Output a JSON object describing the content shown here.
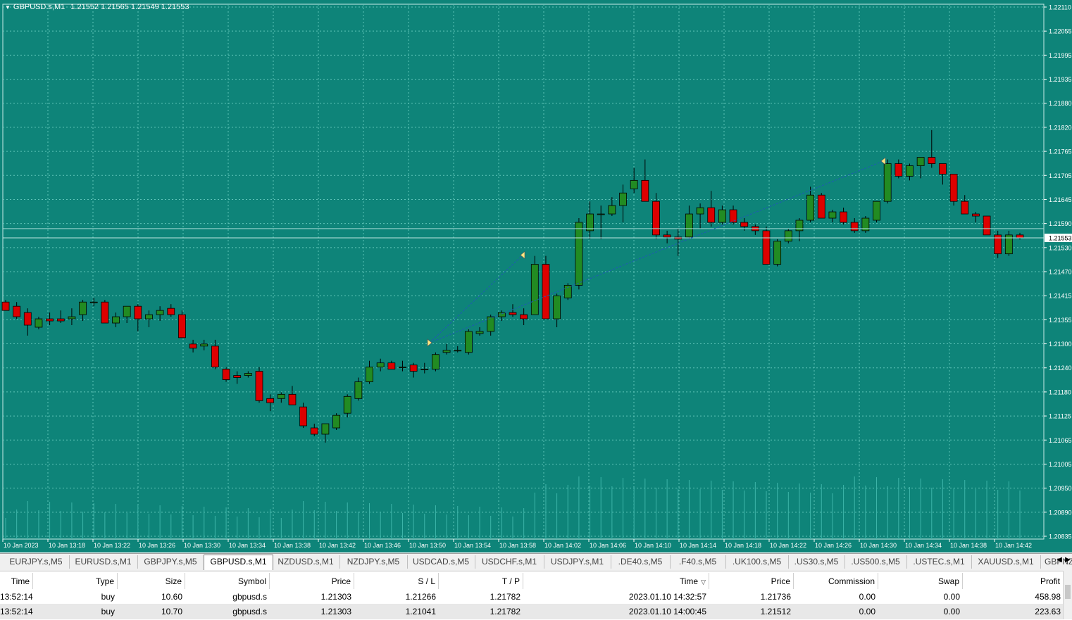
{
  "chart": {
    "symbol": "GBPUSD.s,M1",
    "header_prices": "1.21552 1.21565 1.21549 1.21553",
    "colors": {
      "background": "#0e8479",
      "bull": "#228B22",
      "bear": "#DD0000",
      "grid": "#5ec3b8",
      "trade_line": "#1e5ab4"
    },
    "price_axis_labels": [
      "1.22110",
      "1.22055",
      "1.21995",
      "1.21935",
      "1.21880",
      "1.21820",
      "1.21765",
      "1.21705",
      "1.21645",
      "1.21590",
      "1.21530",
      "1.21470",
      "1.21415",
      "1.21355",
      "1.21300",
      "1.21240",
      "1.21180",
      "1.21125",
      "1.21065",
      "1.21005",
      "1.20950",
      "1.20890",
      "1.20835"
    ],
    "current_price_label": "1.21553",
    "time_axis_labels": [
      "10 Jan 2023",
      "10 Jan 13:18",
      "10 Jan 13:22",
      "10 Jan 13:26",
      "10 Jan 13:30",
      "10 Jan 13:34",
      "10 Jan 13:38",
      "10 Jan 13:42",
      "10 Jan 13:46",
      "10 Jan 13:50",
      "10 Jan 13:54",
      "10 Jan 13:58",
      "10 Jan 14:02",
      "10 Jan 14:06",
      "10 Jan 14:10",
      "10 Jan 14:14",
      "10 Jan 14:18",
      "10 Jan 14:22",
      "10 Jan 14:26",
      "10 Jan 14:30",
      "10 Jan 14:34",
      "10 Jan 14:38",
      "10 Jan 14:42"
    ]
  },
  "chart_data": {
    "type": "candlestick",
    "symbol": "GBPUSD.s",
    "timeframe": "M1",
    "ylim": [
      1.20835,
      1.2211
    ],
    "ohlc": [
      [
        1.214,
        1.21405,
        1.2138,
        1.2138
      ],
      [
        1.2139,
        1.214,
        1.2136,
        1.21365
      ],
      [
        1.21375,
        1.21385,
        1.2132,
        1.21345
      ],
      [
        1.2134,
        1.21365,
        1.21335,
        1.2136
      ],
      [
        1.2136,
        1.21375,
        1.21345,
        1.21355
      ],
      [
        1.2136,
        1.2138,
        1.2135,
        1.21355
      ],
      [
        1.2136,
        1.21385,
        1.21345,
        1.21365
      ],
      [
        1.2137,
        1.21405,
        1.21355,
        1.214
      ],
      [
        1.214,
        1.2141,
        1.2139,
        1.214
      ],
      [
        1.214,
        1.21405,
        1.2135,
        1.2135
      ],
      [
        1.2135,
        1.21375,
        1.2134,
        1.21365
      ],
      [
        1.21365,
        1.2139,
        1.2135,
        1.2139
      ],
      [
        1.2139,
        1.21395,
        1.2133,
        1.2136
      ],
      [
        1.2136,
        1.2138,
        1.2134,
        1.2137
      ],
      [
        1.2137,
        1.2139,
        1.21355,
        1.2138
      ],
      [
        1.21385,
        1.21395,
        1.21365,
        1.2137
      ],
      [
        1.2137,
        1.2138,
        1.21315,
        1.21315
      ],
      [
        1.213,
        1.2131,
        1.2128,
        1.2129
      ],
      [
        1.21295,
        1.2131,
        1.21285,
        1.213
      ],
      [
        1.21295,
        1.2131,
        1.2124,
        1.21245
      ],
      [
        1.2124,
        1.21245,
        1.2121,
        1.21215
      ],
      [
        1.21225,
        1.21235,
        1.21205,
        1.2122
      ],
      [
        1.21225,
        1.21235,
        1.2122,
        1.2123
      ],
      [
        1.21235,
        1.21245,
        1.2116,
        1.21165
      ],
      [
        1.2117,
        1.2118,
        1.2114,
        1.2116
      ],
      [
        1.2117,
        1.21185,
        1.2116,
        1.2118
      ],
      [
        1.2118,
        1.212,
        1.2116,
        1.21155
      ],
      [
        1.2115,
        1.2116,
        1.211,
        1.21105
      ],
      [
        1.211,
        1.2111,
        1.2108,
        1.21085
      ],
      [
        1.21085,
        1.2111,
        1.21065,
        1.2111
      ],
      [
        1.211,
        1.21135,
        1.21095,
        1.2113
      ],
      [
        1.21135,
        1.2118,
        1.21125,
        1.21175
      ],
      [
        1.2117,
        1.2122,
        1.21165,
        1.2121
      ],
      [
        1.2121,
        1.2126,
        1.21205,
        1.21245
      ],
      [
        1.21245,
        1.21265,
        1.21235,
        1.21255
      ],
      [
        1.21255,
        1.2126,
        1.2124,
        1.2124
      ],
      [
        1.21245,
        1.2126,
        1.21235,
        1.21245
      ],
      [
        1.2125,
        1.21255,
        1.2122,
        1.21235
      ],
      [
        1.2124,
        1.21255,
        1.2123,
        1.2124
      ],
      [
        1.2124,
        1.2128,
        1.21235,
        1.21275
      ],
      [
        1.2128,
        1.213,
        1.21275,
        1.21285
      ],
      [
        1.21285,
        1.21295,
        1.2128,
        1.21285
      ],
      [
        1.2128,
        1.21335,
        1.21275,
        1.2133
      ],
      [
        1.21325,
        1.2134,
        1.2132,
        1.2133
      ],
      [
        1.2133,
        1.2137,
        1.2132,
        1.21365
      ],
      [
        1.21365,
        1.2138,
        1.21355,
        1.21375
      ],
      [
        1.21375,
        1.21395,
        1.21365,
        1.2137
      ],
      [
        1.2137,
        1.21385,
        1.21345,
        1.2136
      ],
      [
        1.2137,
        1.2151,
        1.2137,
        1.2149
      ],
      [
        1.2149,
        1.2151,
        1.2136,
        1.2136
      ],
      [
        1.2136,
        1.2142,
        1.2134,
        1.21415
      ],
      [
        1.2141,
        1.21445,
        1.21405,
        1.2144
      ],
      [
        1.2144,
        1.216,
        1.2143,
        1.2159
      ],
      [
        1.2157,
        1.2164,
        1.2155,
        1.2161
      ],
      [
        1.2161,
        1.2163,
        1.2155,
        1.2161
      ],
      [
        1.2161,
        1.2165,
        1.21605,
        1.2163
      ],
      [
        1.2163,
        1.2168,
        1.2159,
        1.2166
      ],
      [
        1.2167,
        1.2172,
        1.2166,
        1.2169
      ],
      [
        1.2169,
        1.2174,
        1.2164,
        1.2164
      ],
      [
        1.2164,
        1.2166,
        1.2155,
        1.2156
      ],
      [
        1.2156,
        1.2157,
        1.2154,
        1.21555
      ],
      [
        1.21555,
        1.21575,
        1.2151,
        1.2155
      ],
      [
        1.21555,
        1.2163,
        1.2155,
        1.2161
      ],
      [
        1.2161,
        1.21635,
        1.21575,
        1.21625
      ],
      [
        1.21625,
        1.21665,
        1.2158,
        1.2159
      ],
      [
        1.2159,
        1.2163,
        1.21585,
        1.2162
      ],
      [
        1.2162,
        1.2163,
        1.21585,
        1.2159
      ],
      [
        1.2159,
        1.216,
        1.2157,
        1.2158
      ],
      [
        1.2158,
        1.21585,
        1.2156,
        1.2157
      ],
      [
        1.2157,
        1.2158,
        1.2149,
        1.2149
      ],
      [
        1.2149,
        1.2155,
        1.21485,
        1.21545
      ],
      [
        1.21545,
        1.21575,
        1.2154,
        1.2157
      ],
      [
        1.2157,
        1.216,
        1.21545,
        1.21595
      ],
      [
        1.21595,
        1.21675,
        1.2159,
        1.21655
      ],
      [
        1.21655,
        1.2166,
        1.216,
        1.216
      ],
      [
        1.216,
        1.2162,
        1.2159,
        1.21615
      ],
      [
        1.21615,
        1.21625,
        1.21585,
        1.2159
      ],
      [
        1.2159,
        1.216,
        1.21565,
        1.2157
      ],
      [
        1.2157,
        1.21605,
        1.21565,
        1.216
      ],
      [
        1.21595,
        1.2164,
        1.2159,
        1.2164
      ],
      [
        1.2164,
        1.2174,
        1.21635,
        1.2173
      ],
      [
        1.2173,
        1.2174,
        1.21695,
        1.217
      ],
      [
        1.217,
        1.2173,
        1.2169,
        1.21725
      ],
      [
        1.21725,
        1.21745,
        1.21695,
        1.21745
      ],
      [
        1.21745,
        1.2181,
        1.2172,
        1.2173
      ],
      [
        1.2173,
        1.2173,
        1.2168,
        1.21705
      ],
      [
        1.21705,
        1.21705,
        1.2163,
        1.2164
      ],
      [
        1.2164,
        1.21655,
        1.2161,
        1.2161
      ],
      [
        1.2161,
        1.21615,
        1.2159,
        1.21605
      ],
      [
        1.21605,
        1.21605,
        1.2156,
        1.2156
      ],
      [
        1.2156,
        1.2157,
        1.21505,
        1.21515
      ],
      [
        1.21515,
        1.2157,
        1.2151,
        1.2156
      ],
      [
        1.2156,
        1.21565,
        1.21549,
        1.21553
      ]
    ],
    "volume_note": "tick volume histogram",
    "trades": [
      {
        "entry_time": "13:52:14",
        "entry_price": 1.21303,
        "exit_time": "14:32:57",
        "exit_price": 1.21736,
        "type": "buy"
      },
      {
        "entry_time": "13:52:14",
        "entry_price": 1.21303,
        "exit_time": "14:00:45",
        "exit_price": 1.21512,
        "type": "buy"
      }
    ]
  },
  "tabs": {
    "items": [
      "EURJPY.s,M5",
      "EURUSD.s,M1",
      "GBPJPY.s,M5",
      "GBPUSD.s,M1",
      "NZDUSD.s,M1",
      "NZDJPY.s,M5",
      "USDCAD.s,M5",
      "USDCHF.s,M1",
      "USDJPY.s,M1",
      ".DE40.s,M5",
      ".F40.s,M5",
      ".UK100.s,M5",
      ".US30.s,M5",
      ".US500.s,M5",
      ".USTEC.s,M1",
      "XAUUSD.s,M1",
      "GBPNZD"
    ],
    "active": "GBPUSD.s,M1"
  },
  "table": {
    "headers": [
      "Time",
      "Type",
      "Size",
      "Symbol",
      "Price",
      "S / L",
      "T / P",
      "Time",
      "Price",
      "Commission",
      "Swap",
      "Profit"
    ],
    "rows": [
      [
        "13:52:14",
        "buy",
        "10.60",
        "gbpusd.s",
        "1.21303",
        "1.21266",
        "1.21782",
        "2023.01.10 14:32:57",
        "1.21736",
        "0.00",
        "0.00",
        "458.98"
      ],
      [
        "13:52:14",
        "buy",
        "10.70",
        "gbpusd.s",
        "1.21303",
        "1.21041",
        "1.21782",
        "2023.01.10 14:00:45",
        "1.21512",
        "0.00",
        "0.00",
        "223.63"
      ]
    ]
  }
}
